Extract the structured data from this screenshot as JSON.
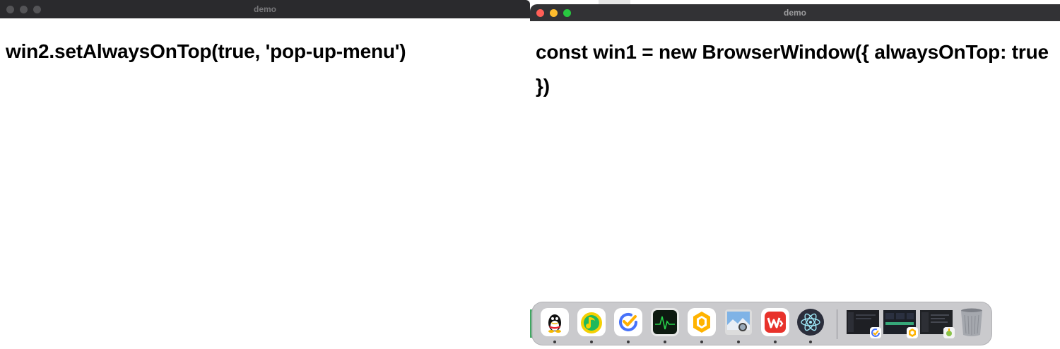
{
  "window_back": {
    "title": "demo",
    "text": "win2.setAlwaysOnTop(true, 'pop-up-menu')"
  },
  "window_front": {
    "title": "demo",
    "text": "const win1 = new BrowserWindow({ alwaysOnTop: true })"
  },
  "dock": {
    "apps": [
      {
        "icon": "qq-icon",
        "running": true
      },
      {
        "icon": "qq-music-icon",
        "running": true
      },
      {
        "icon": "ticktick-icon",
        "running": true
      },
      {
        "icon": "activity-monitor-icon",
        "running": true
      },
      {
        "icon": "ant-app-icon",
        "running": true
      },
      {
        "icon": "preview-icon",
        "running": true
      },
      {
        "icon": "wps-office-icon",
        "running": true
      },
      {
        "icon": "electron-icon",
        "running": true
      }
    ],
    "minimized": [
      "window-thumbnail-1",
      "window-thumbnail-2",
      "window-thumbnail-3"
    ],
    "trash": "trash-icon"
  },
  "colors": {
    "titlebar_inactive": "#2a2a2d",
    "titlebar_active": "#323235",
    "close": "#ff5f57",
    "minimize": "#febc2e",
    "zoom": "#28c840"
  }
}
